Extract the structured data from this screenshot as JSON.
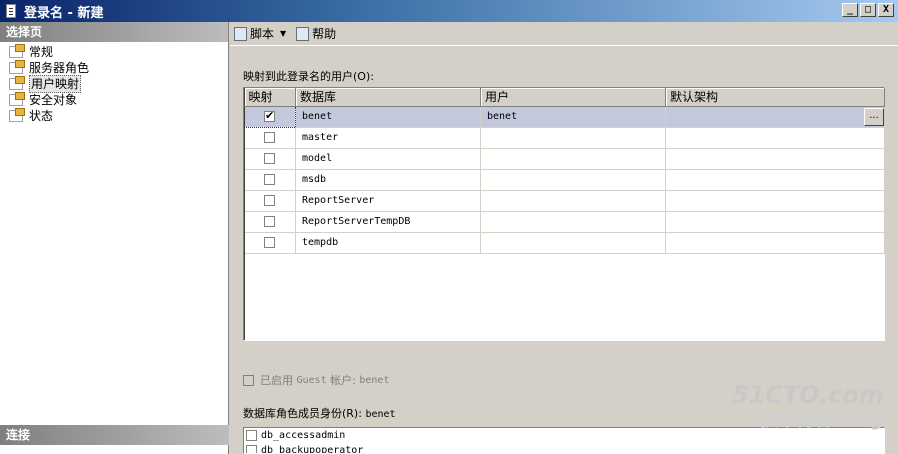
{
  "window": {
    "title": "登录名 - 新建",
    "buttons": {
      "minimize": "_",
      "maximize": "□",
      "close": "X"
    }
  },
  "sidebar": {
    "header": "选择页",
    "items": [
      {
        "label": "常规"
      },
      {
        "label": "服务器角色"
      },
      {
        "label": "用户映射",
        "selected": true
      },
      {
        "label": "安全对象"
      },
      {
        "label": "状态"
      }
    ],
    "connection_header": "连接"
  },
  "toolbar": {
    "script_label": "脚本",
    "help_label": "帮助"
  },
  "mapping": {
    "label": "映射到此登录名的用户(O):",
    "columns": [
      "映射",
      "数据库",
      "用户",
      "默认架构"
    ],
    "rows": [
      {
        "mapped": true,
        "database": "benet",
        "user": "benet",
        "schema": "",
        "selected": true
      },
      {
        "mapped": false,
        "database": "master",
        "user": "",
        "schema": ""
      },
      {
        "mapped": false,
        "database": "model",
        "user": "",
        "schema": ""
      },
      {
        "mapped": false,
        "database": "msdb",
        "user": "",
        "schema": ""
      },
      {
        "mapped": false,
        "database": "ReportServer",
        "user": "",
        "schema": ""
      },
      {
        "mapped": false,
        "database": "ReportServerTempDB",
        "user": "",
        "schema": ""
      },
      {
        "mapped": false,
        "database": "tempdb",
        "user": "",
        "schema": ""
      }
    ],
    "ellipsis": "..."
  },
  "guest": {
    "label_prefix": "已启用",
    "label_guest": "Guest",
    "label_account": "帐户:",
    "label_db": "benet"
  },
  "roles": {
    "label_prefix": "数据库角色成员身份(R):",
    "label_db": "benet",
    "items": [
      "db_accessadmin",
      "db_backupoperator"
    ]
  },
  "watermark": {
    "line1": "51CTO.com",
    "line2": "技术博客 Blog"
  }
}
